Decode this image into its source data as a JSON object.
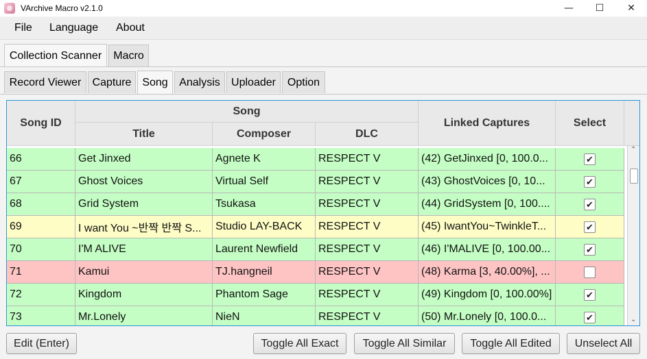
{
  "window": {
    "title": "VArchive Macro v2.1.0",
    "min_glyph": "—",
    "max_glyph": "☐",
    "close_glyph": "✕"
  },
  "menubar": {
    "items": [
      "File",
      "Language",
      "About"
    ]
  },
  "main_tabs": [
    {
      "label": "Collection Scanner",
      "active": true
    },
    {
      "label": "Macro",
      "active": false
    }
  ],
  "sub_tabs": [
    {
      "label": "Record Viewer",
      "active": false
    },
    {
      "label": "Capture",
      "active": false
    },
    {
      "label": "Song",
      "active": true
    },
    {
      "label": "Analysis",
      "active": false
    },
    {
      "label": "Uploader",
      "active": false
    },
    {
      "label": "Option",
      "active": false
    }
  ],
  "table": {
    "headers": {
      "song_id": "Song ID",
      "song_group": "Song",
      "title": "Title",
      "composer": "Composer",
      "dlc": "DLC",
      "linked_captures": "Linked Captures",
      "select": "Select"
    },
    "rows": [
      {
        "id": "66",
        "title": "Get Jinxed",
        "composer": "Agnete K",
        "dlc": "RESPECT V",
        "captures": "(42) GetJinxed [0, 100.0...",
        "checked": true,
        "status": "green"
      },
      {
        "id": "67",
        "title": "Ghost Voices",
        "composer": "Virtual Self",
        "dlc": "RESPECT V",
        "captures": "(43) GhostVoices [0, 10...",
        "checked": true,
        "status": "green"
      },
      {
        "id": "68",
        "title": "Grid System",
        "composer": "Tsukasa",
        "dlc": "RESPECT V",
        "captures": "(44) GridSystem [0, 100....",
        "checked": true,
        "status": "green"
      },
      {
        "id": "69",
        "title": "I want You ~반짝 반짝 S...",
        "composer": "Studio LAY-BACK",
        "dlc": "RESPECT V",
        "captures": "(45) IwantYou~TwinkleT...",
        "checked": true,
        "status": "yellow"
      },
      {
        "id": "70",
        "title": "I'M ALIVE",
        "composer": "Laurent Newfield",
        "dlc": "RESPECT V",
        "captures": "(46) I'MALIVE [0, 100.00...",
        "checked": true,
        "status": "green"
      },
      {
        "id": "71",
        "title": "Kamui",
        "composer": "TJ.hangneil",
        "dlc": "RESPECT V",
        "captures": "(48) Karma [3, 40.00%], ...",
        "checked": false,
        "status": "red"
      },
      {
        "id": "72",
        "title": "Kingdom",
        "composer": "Phantom Sage",
        "dlc": "RESPECT V",
        "captures": "(49) Kingdom [0, 100.00%]",
        "checked": true,
        "status": "green"
      },
      {
        "id": "73",
        "title": "Mr.Lonely",
        "composer": "NieN",
        "dlc": "RESPECT V",
        "captures": "(50) Mr.Lonely [0, 100.0...",
        "checked": true,
        "status": "green"
      }
    ],
    "check_glyph": "✔"
  },
  "buttons": {
    "edit": "Edit (Enter)",
    "toggle_exact": "Toggle All Exact",
    "toggle_similar": "Toggle All Similar",
    "toggle_edited": "Toggle All Edited",
    "unselect_all": "Unselect All"
  },
  "colors": {
    "row_green": "#c4fec4",
    "row_yellow": "#fdfdc5",
    "row_red": "#fec4c4",
    "table_focus_border": "#2a95d6"
  }
}
